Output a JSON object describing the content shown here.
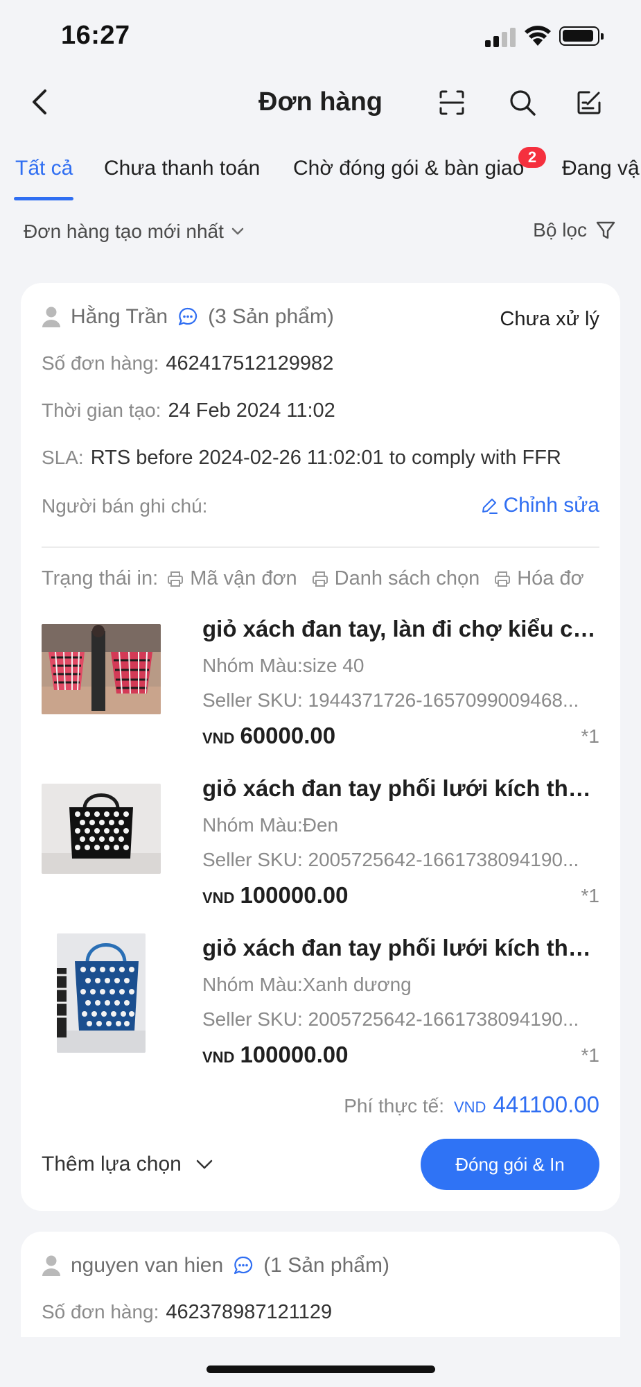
{
  "status_bar": {
    "time": "16:27"
  },
  "header": {
    "title": "Đơn hàng",
    "icons": [
      "back-arrow-icon",
      "scan-icon",
      "search-icon",
      "edit-note-icon"
    ]
  },
  "tabs": [
    {
      "label": "Tất cả",
      "active": true
    },
    {
      "label": "Chưa thanh toán",
      "active": false
    },
    {
      "label": "Chờ đóng gói & bàn giao",
      "active": false,
      "badge": "2"
    },
    {
      "label": "Đang vậ",
      "active": false
    }
  ],
  "sort": {
    "label": "Đơn hàng tạo mới nhất"
  },
  "filter": {
    "label": "Bộ lọc"
  },
  "orders": [
    {
      "buyer": "Hằng Trần",
      "product_count": "(3 Sản phẩm)",
      "status": "Chưa xử lý",
      "order_no_label": "Số đơn hàng:",
      "order_no": "462417512129982",
      "created_label": "Thời gian tạo:",
      "created": "24 Feb 2024 11:02",
      "sla_label": "SLA:",
      "sla": "RTS before 2024-02-26 11:02:01 to comply with FFR",
      "note_label": "Người bán ghi chú:",
      "edit_label": "Chỉnh sửa",
      "print_label": "Trạng thái in:",
      "print_items": [
        "Mã vận đơn",
        "Danh sách chọn",
        "Hóa đơ"
      ],
      "products": [
        {
          "name": "giỏ xách đan tay, làn đi chợ kiểu ch...",
          "variant": "Nhóm Màu:size 40",
          "sku": "Seller SKU: 1944371726-1657099009468...",
          "currency": "VND",
          "price": "60000.00",
          "qty": "*1"
        },
        {
          "name": "giỏ xách đan tay phối lưới kích thướ...",
          "variant": "Nhóm Màu:Đen",
          "sku": "Seller SKU: 2005725642-1661738094190...",
          "currency": "VND",
          "price": "100000.00",
          "qty": "*1"
        },
        {
          "name": "giỏ xách đan tay phối lưới kích thướ...",
          "variant": "Nhóm Màu:Xanh dương",
          "sku": "Seller SKU: 2005725642-1661738094190...",
          "currency": "VND",
          "price": "100000.00",
          "qty": "*1"
        }
      ],
      "total_label": "Phí thực tế:",
      "total_currency": "VND",
      "total": "441100.00",
      "more_label": "Thêm lựa chọn",
      "action_label": "Đóng gói & In"
    },
    {
      "buyer": "nguyen van hien",
      "product_count": "(1 Sản phẩm)",
      "order_no_label": "Số đơn hàng:",
      "order_no": "462378987121129"
    }
  ],
  "colors": {
    "accent": "#2f6ef2",
    "background": "#f3f4f7",
    "badge": "#f5303e",
    "primary_button": "#2f73f5"
  }
}
